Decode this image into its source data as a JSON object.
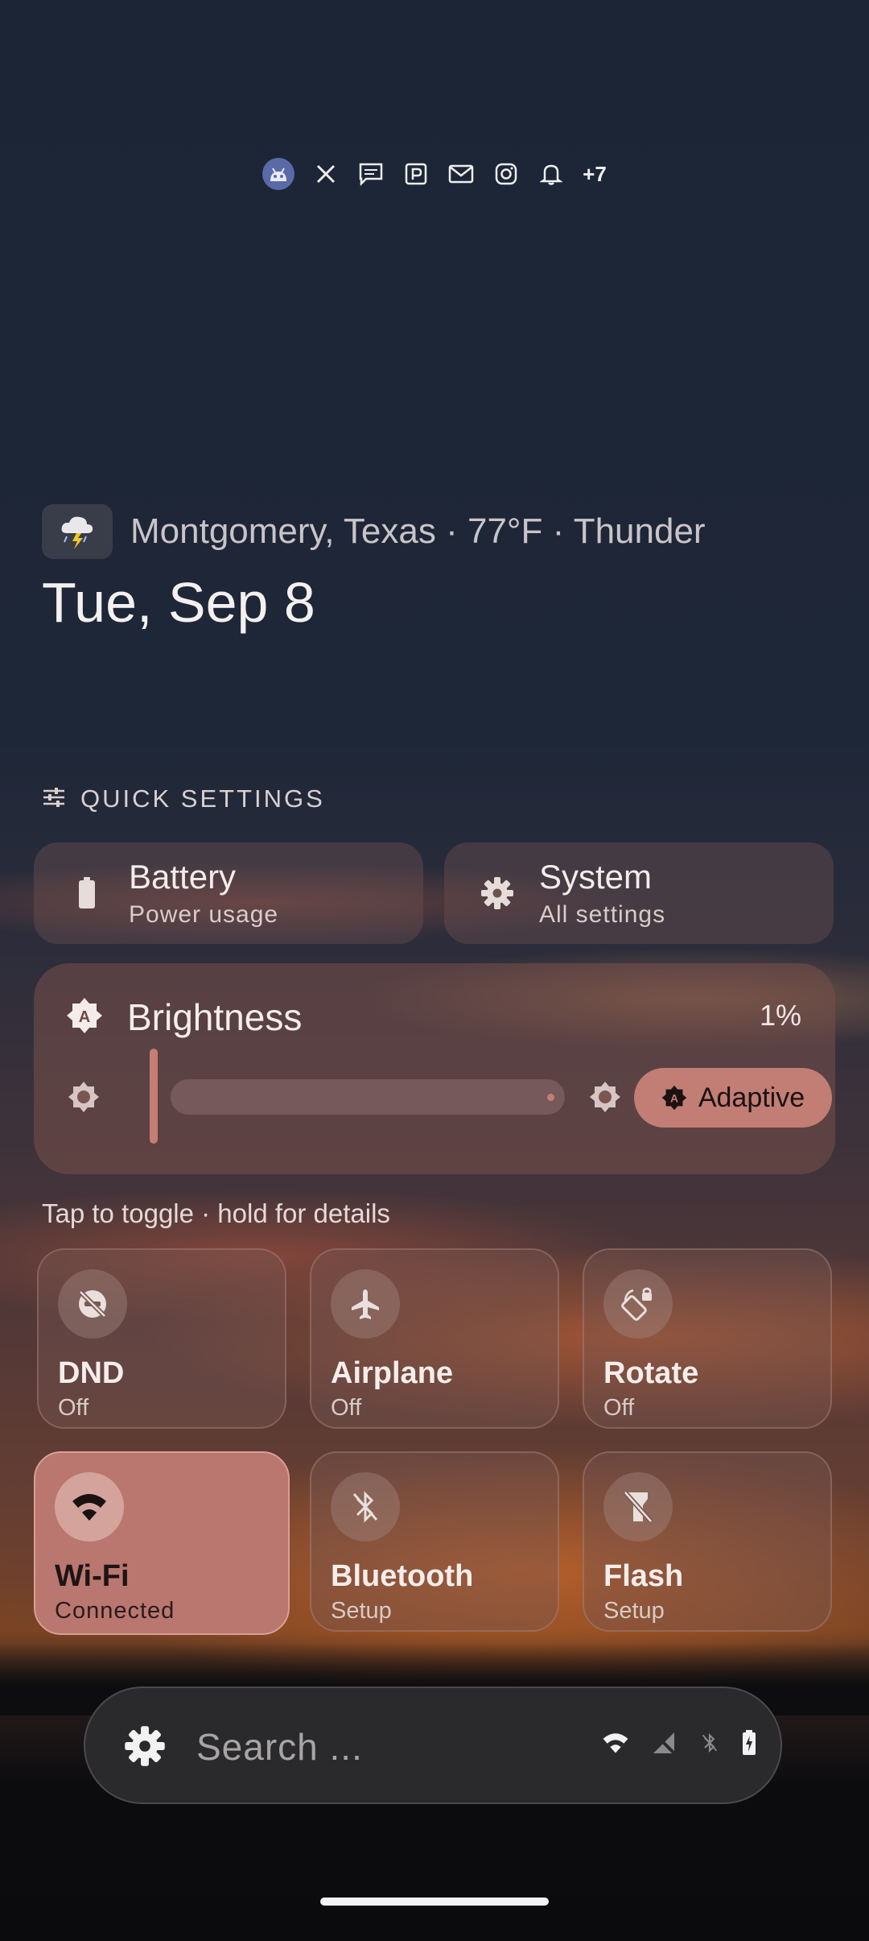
{
  "notifications": {
    "icons": [
      "android-avatar-icon",
      "x-icon",
      "message-icon",
      "pinterest-icon",
      "mail-icon",
      "instagram-icon",
      "bell-icon"
    ],
    "more_count": "+7"
  },
  "weather": {
    "icon": "thunderstorm-icon",
    "text": "Montgomery, Texas · 77°F · Thunder"
  },
  "date": "Tue, Sep 8",
  "quick_settings": {
    "header": "QUICK SETTINGS",
    "cards": [
      {
        "title": "Battery",
        "subtitle": "Power usage",
        "icon": "battery-icon"
      },
      {
        "title": "System",
        "subtitle": "All settings",
        "icon": "gear-icon"
      }
    ]
  },
  "brightness": {
    "title": "Brightness",
    "percent": "1%",
    "level": 0.01,
    "adaptive_label": "Adaptive"
  },
  "hint": "Tap to toggle · hold for details",
  "tiles": [
    {
      "title": "DND",
      "subtitle": "Off",
      "icon": "dnd-off-icon",
      "active": false
    },
    {
      "title": "Airplane",
      "subtitle": "Off",
      "icon": "airplane-icon",
      "active": false
    },
    {
      "title": "Rotate",
      "subtitle": "Off",
      "icon": "rotate-lock-icon",
      "active": false
    },
    {
      "title": "Wi-Fi",
      "subtitle": "Connected",
      "icon": "wifi-icon",
      "active": true
    },
    {
      "title": "Bluetooth",
      "subtitle": "Setup",
      "icon": "bluetooth-off-icon",
      "active": false
    },
    {
      "title": "Flash",
      "subtitle": "Setup",
      "icon": "flashlight-off-icon",
      "active": false
    }
  ],
  "search": {
    "placeholder": "Search ...",
    "status_icons": [
      "wifi-icon",
      "cellular-off-icon",
      "bluetooth-icon",
      "battery-charging-icon"
    ]
  },
  "colors": {
    "accent": "#c27d74",
    "tile_active": "#b9776f"
  }
}
